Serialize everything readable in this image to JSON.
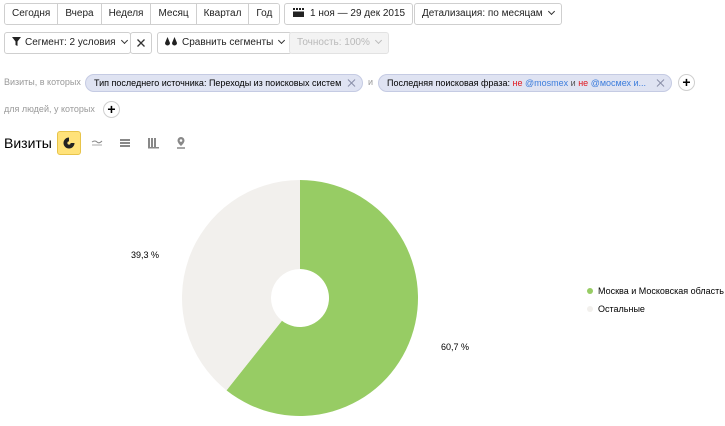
{
  "periods": [
    "Сегодня",
    "Вчера",
    "Неделя",
    "Месяц",
    "Квартал",
    "Год"
  ],
  "date_range": "1 ноя — 29 дек 2015",
  "detail": "Детализация: по месяцам",
  "segment": "Сегмент: 2 условия",
  "compare": "Сравнить сегменты",
  "accuracy": "Точность: 100%",
  "filters": {
    "visits_label": "Визиты, в которых",
    "chip1": "Тип последнего источника: Переходы из поисковых систем",
    "and_label": "и",
    "chip2_prefix": "Последняя поисковая фраза:",
    "chip2_neg1": "не",
    "chip2_val1": "@mosmex",
    "chip2_and": "и",
    "chip2_neg2": "не",
    "chip2_val2": "@мосмех и...",
    "people_label": "для людей, у которых",
    "plus": "+"
  },
  "section_title": "Визиты",
  "icons": {
    "calendar": "calendar-icon",
    "segment": "filter-icon",
    "compare": "compare-icon",
    "views": [
      "pie-chart-icon",
      "line-chart-icon",
      "area-chart-icon",
      "bar-chart-icon",
      "map-icon"
    ]
  },
  "colors": {
    "moscow": "#97cc64",
    "others": "#f2f0ed"
  },
  "chart_data": {
    "type": "pie",
    "donut": true,
    "slices": [
      {
        "label": "Москва и Московская область",
        "value": 60.7,
        "display": "60,7 %"
      },
      {
        "label": "Остальные",
        "value": 39.3,
        "display": "39,3 %"
      }
    ],
    "legend_position": "right"
  }
}
